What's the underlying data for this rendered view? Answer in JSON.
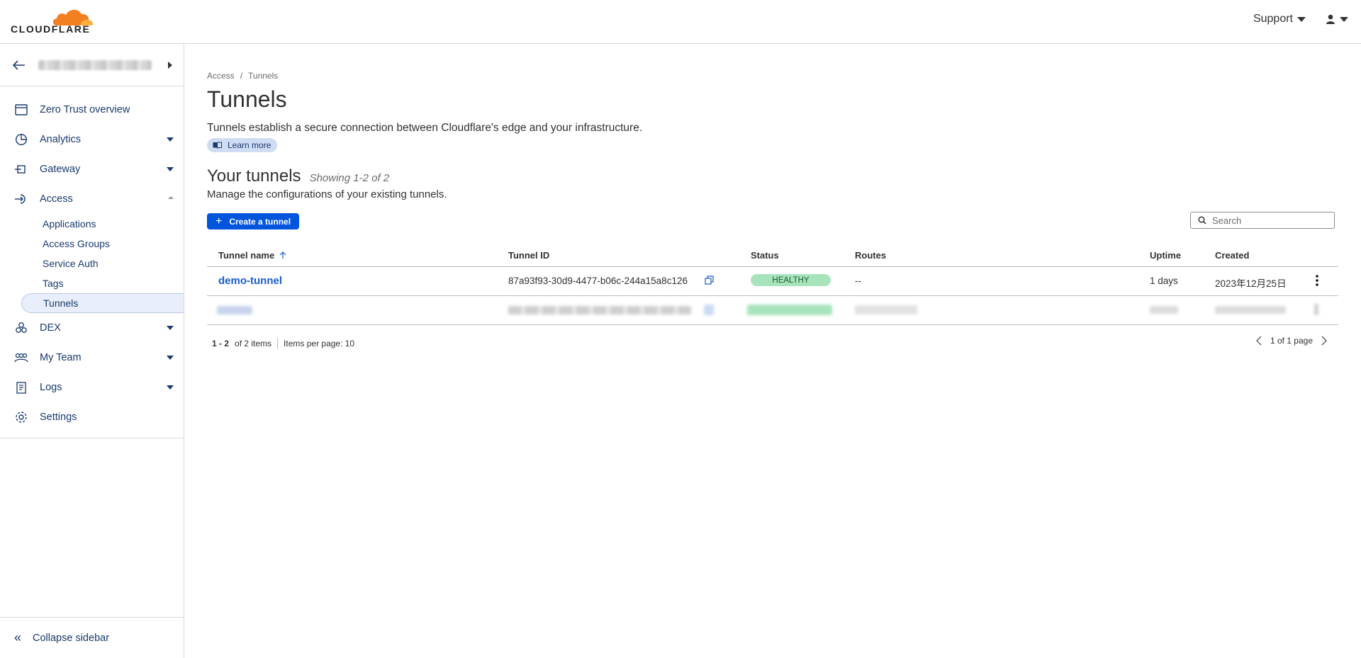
{
  "brand": {
    "name": "CLOUDFLARE",
    "cloud_color": "#f38020",
    "accent": "#0055dc"
  },
  "header": {
    "support_label": "Support",
    "user_icon": "user-icon"
  },
  "sidebar": {
    "back_icon": "arrow-left-icon",
    "nav": [
      {
        "label": "Zero Trust overview",
        "icon": "browser-icon",
        "dropdown": false
      },
      {
        "label": "Analytics",
        "icon": "pie-chart-icon",
        "dropdown": true
      },
      {
        "label": "Gateway",
        "icon": "gateway-icon",
        "dropdown": true
      },
      {
        "label": "Access",
        "icon": "access-icon",
        "dropdown": true,
        "expanded": true
      }
    ],
    "access_sub": [
      "Applications",
      "Access Groups",
      "Service Auth",
      "Tags",
      "Tunnels"
    ],
    "nav2": [
      {
        "label": "DEX",
        "icon": "dex-icon",
        "dropdown": true
      },
      {
        "label": "My Team",
        "icon": "team-icon",
        "dropdown": true
      },
      {
        "label": "Logs",
        "icon": "logs-icon",
        "dropdown": true
      },
      {
        "label": "Settings",
        "icon": "gear-icon",
        "dropdown": false
      }
    ],
    "collapse_label": "Collapse sidebar"
  },
  "breadcrumb": {
    "parent": "Access",
    "separator": "/",
    "current": "Tunnels"
  },
  "page": {
    "title": "Tunnels",
    "description": "Tunnels establish a secure connection between Cloudflare's edge and your infrastructure.",
    "learn_more": "Learn more"
  },
  "section": {
    "title": "Your tunnels",
    "showing": "Showing 1-2 of 2",
    "description": "Manage the configurations of your existing tunnels.",
    "create_button": "Create a tunnel",
    "search_placeholder": "Search"
  },
  "table": {
    "columns": [
      "Tunnel name",
      "Tunnel ID",
      "Status",
      "Routes",
      "Uptime",
      "Created"
    ],
    "rows": [
      {
        "name": "demo-tunnel",
        "id": "87a93f93-30d9-4477-b06c-244a15a8c126",
        "status": "HEALTHY",
        "routes": "--",
        "uptime": "1 days",
        "created": "2023年12月25日"
      }
    ]
  },
  "pagination": {
    "range": "1 - 2",
    "of_items": "of 2 items",
    "per_page": "Items per page: 10",
    "page_info": "1 of 1 page"
  }
}
